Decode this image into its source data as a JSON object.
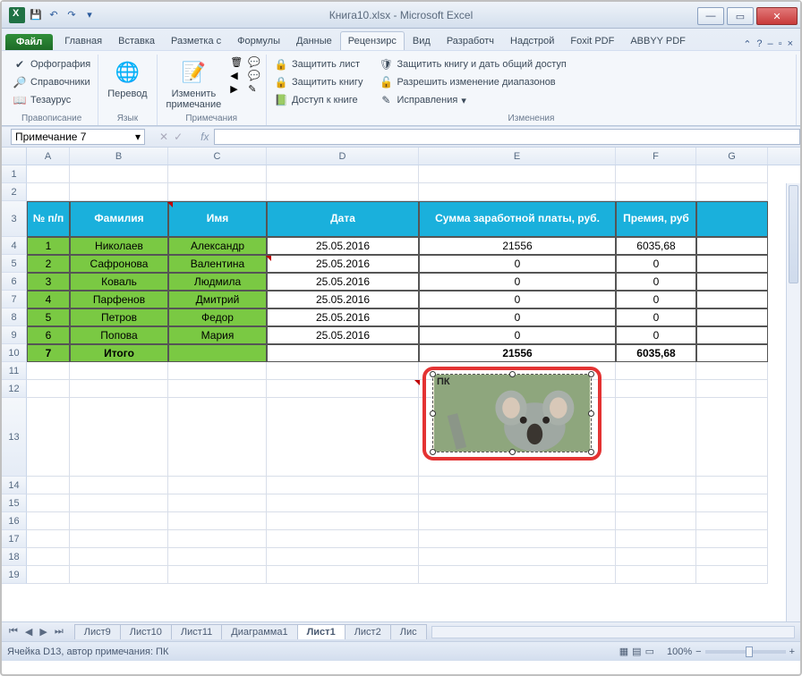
{
  "title": "Книга10.xlsx  -  Microsoft Excel",
  "qat": {
    "save": "💾",
    "undo": "↶",
    "redo": "↷"
  },
  "ribbon": {
    "file": "Файл",
    "tabs": [
      "Главная",
      "Вставка",
      "Разметка с",
      "Формулы",
      "Данные",
      "Рецензирс",
      "Вид",
      "Разработч",
      "Надстрой",
      "Foxit PDF",
      "ABBYY PDF"
    ],
    "active": 5,
    "help": "?"
  },
  "groups": {
    "proofing": {
      "label": "Правописание",
      "spelling": "Орфография",
      "research": "Справочники",
      "thesaurus": "Тезаурус"
    },
    "language": {
      "label": "Язык",
      "translate": "Перевод"
    },
    "comments": {
      "label": "Примечания",
      "edit": "Изменить\nпримечание"
    },
    "changes": {
      "label": "Изменения",
      "protect_sheet": "Защитить лист",
      "protect_book": "Защитить книгу",
      "share_book": "Доступ к книге",
      "protect_share": "Защитить книгу и дать общий доступ",
      "allow_ranges": "Разрешить изменение диапазонов",
      "track": "Исправления"
    }
  },
  "namebox": "Примечание 7",
  "columns": [
    "A",
    "B",
    "C",
    "D",
    "E",
    "F",
    "G"
  ],
  "table": {
    "headers": [
      "№ п/п",
      "Фамилия",
      "Имя",
      "Дата",
      "Сумма заработной платы, руб.",
      "Премия, руб"
    ],
    "rows": [
      [
        "1",
        "Николаев",
        "Александр",
        "25.05.2016",
        "21556",
        "6035,68"
      ],
      [
        "2",
        "Сафронова",
        "Валентина",
        "25.05.2016",
        "0",
        "0"
      ],
      [
        "3",
        "Коваль",
        "Людмила",
        "25.05.2016",
        "0",
        "0"
      ],
      [
        "4",
        "Парфенов",
        "Дмитрий",
        "25.05.2016",
        "0",
        "0"
      ],
      [
        "5",
        "Петров",
        "Федор",
        "25.05.2016",
        "0",
        "0"
      ],
      [
        "6",
        "Попова",
        "Мария",
        "25.05.2016",
        "0",
        "0"
      ],
      [
        "7",
        "Итого",
        "",
        "",
        "21556",
        "6035,68"
      ]
    ]
  },
  "row_numbers": [
    1,
    2,
    3,
    4,
    5,
    6,
    7,
    8,
    9,
    10,
    11,
    12,
    13,
    14,
    15,
    16,
    17,
    18,
    19
  ],
  "comment": {
    "author_short": "ПК"
  },
  "sheets": {
    "nav": [
      "⏮",
      "◀",
      "▶",
      "⏭"
    ],
    "tabs": [
      "Лист9",
      "Лист10",
      "Лист11",
      "Диаграмма1",
      "Лист1",
      "Лист2",
      "Лис"
    ],
    "active": 4
  },
  "status": {
    "text": "Ячейка D13, автор примечания: ПК",
    "zoom": "100%",
    "minus": "−",
    "plus": "+"
  }
}
